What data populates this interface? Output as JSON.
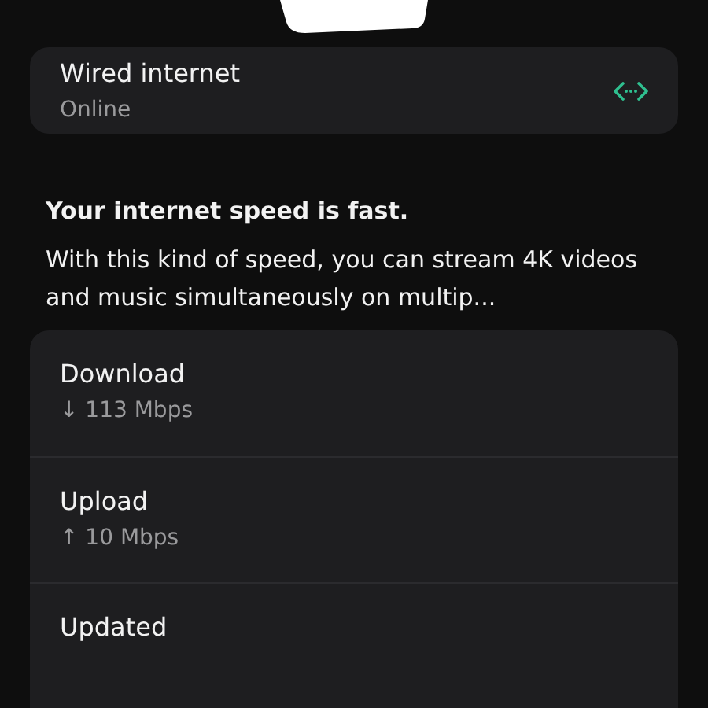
{
  "connection": {
    "title": "Wired internet",
    "status": "Online"
  },
  "summary": {
    "heading": "Your internet speed is fast.",
    "text": "With this kind of speed, you can stream 4K videos and music simultaneously on multip..."
  },
  "stats": [
    {
      "label": "Download",
      "value": "↓ 113 Mbps"
    },
    {
      "label": "Upload",
      "value": "↑ 10 Mbps"
    },
    {
      "label": "Updated"
    }
  ]
}
